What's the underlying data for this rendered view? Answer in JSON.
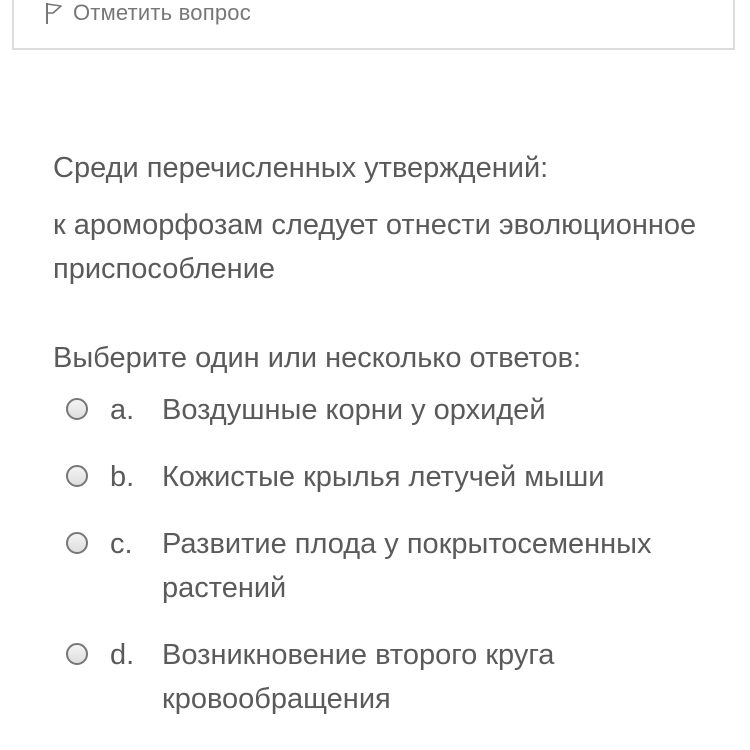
{
  "flag": {
    "label": "Отметить вопрос",
    "icon": "flag-icon"
  },
  "question": {
    "line1": "Среди перечисленных утверждений:",
    "line2": "к ароморфозам следует отнести эволюционное  приспособление"
  },
  "prompt": "Выберите один или несколько ответов:",
  "answers": [
    {
      "letter": "a.",
      "text": "Воздушные корни у орхидей",
      "checked": false
    },
    {
      "letter": "b.",
      "text": "Кожистые крылья летучей мыши",
      "checked": false
    },
    {
      "letter": "c.",
      "text": "Развитие плода у покрытосеменных растений",
      "checked": false
    },
    {
      "letter": "d.",
      "text": "Возникновение второго круга кровообращения",
      "checked": false
    }
  ]
}
